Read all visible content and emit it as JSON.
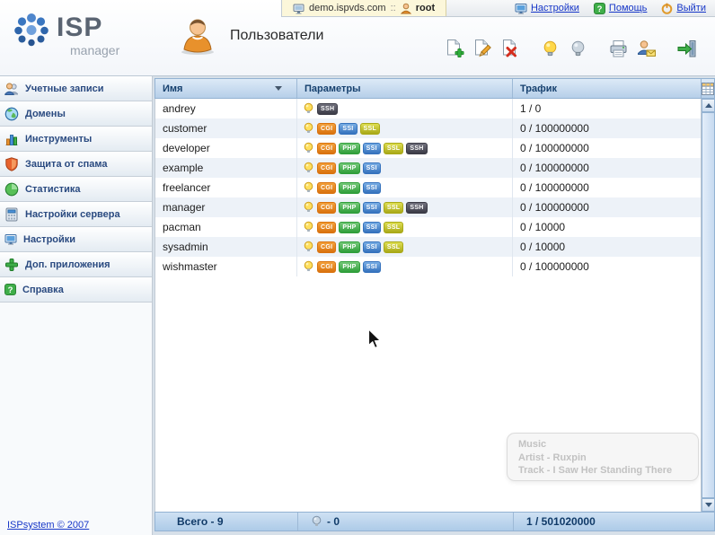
{
  "topbar": {
    "host": "demo.ispvds.com",
    "separator": "::",
    "user": "root",
    "links": [
      {
        "name": "settings-link",
        "icon": "monitor-icon",
        "label": "Настройки"
      },
      {
        "name": "help-link",
        "icon": "question-icon",
        "label": "Помощь"
      },
      {
        "name": "logout-link",
        "icon": "power-icon",
        "label": "Выйти"
      }
    ]
  },
  "logo": {
    "top": "ISP",
    "bottom": "manager"
  },
  "header": {
    "title": "Пользователи"
  },
  "toolbar": [
    {
      "name": "new-user-button",
      "icon": "doc-add-icon",
      "gap": false
    },
    {
      "name": "edit-user-button",
      "icon": "doc-edit-icon",
      "gap": false
    },
    {
      "name": "delete-user-button",
      "icon": "doc-delete-icon",
      "gap": false
    },
    {
      "name": "enable-user-button",
      "icon": "bulb-on-icon",
      "gap": true
    },
    {
      "name": "disable-user-button",
      "icon": "bulb-off-icon",
      "gap": false
    },
    {
      "name": "print-button",
      "icon": "printer-icon",
      "gap": true
    },
    {
      "name": "mail-password-button",
      "icon": "user-mail-icon",
      "gap": false
    },
    {
      "name": "login-as-user-button",
      "icon": "login-icon",
      "gap": true
    }
  ],
  "sidebar": {
    "items": [
      {
        "name": "accounts",
        "icon": "accounts-icon",
        "label": "Учетные записи"
      },
      {
        "name": "domains",
        "icon": "globe-icon",
        "label": "Домены"
      },
      {
        "name": "tools",
        "icon": "chart-icon",
        "label": "Инструменты"
      },
      {
        "name": "antispam",
        "icon": "shield-icon",
        "label": "Защита от спама"
      },
      {
        "name": "statistics",
        "icon": "stats-icon",
        "label": "Статистика"
      },
      {
        "name": "server-settings",
        "icon": "server-icon",
        "label": "Настройки сервера"
      },
      {
        "name": "settings",
        "icon": "monitor-icon",
        "label": "Настройки"
      },
      {
        "name": "addons",
        "icon": "plus-icon",
        "label": "Доп. приложения"
      },
      {
        "name": "help",
        "icon": "question-icon",
        "label": "Справка"
      }
    ],
    "copyright": "ISPsystem © 2007"
  },
  "table": {
    "columns": [
      {
        "label": "Имя",
        "sorted": true
      },
      {
        "label": "Параметры",
        "sorted": false
      },
      {
        "label": "Трафик",
        "sorted": false
      }
    ],
    "rows": [
      {
        "name": "andrey",
        "enabled": true,
        "badges": [
          "SSH"
        ],
        "traffic": "1 / 0"
      },
      {
        "name": "customer",
        "enabled": true,
        "badges": [
          "CGI",
          "SSI",
          "SSL"
        ],
        "traffic": "0 / 100000000"
      },
      {
        "name": "developer",
        "enabled": true,
        "badges": [
          "CGI",
          "PHP",
          "SSI",
          "SSL",
          "SSH"
        ],
        "traffic": "0 / 100000000"
      },
      {
        "name": "example",
        "enabled": true,
        "badges": [
          "CGI",
          "PHP",
          "SSI"
        ],
        "traffic": "0 / 100000000"
      },
      {
        "name": "freelancer",
        "enabled": true,
        "badges": [
          "CGI",
          "PHP",
          "SSI"
        ],
        "traffic": "0 / 100000000"
      },
      {
        "name": "manager",
        "enabled": true,
        "badges": [
          "CGI",
          "PHP",
          "SSI",
          "SSL",
          "SSH"
        ],
        "traffic": "0 / 100000000"
      },
      {
        "name": "pacman",
        "enabled": true,
        "badges": [
          "CGI",
          "PHP",
          "SSI",
          "SSL"
        ],
        "traffic": "0 / 10000"
      },
      {
        "name": "sysadmin",
        "enabled": true,
        "badges": [
          "CGI",
          "PHP",
          "SSI",
          "SSL"
        ],
        "traffic": "0 / 10000"
      },
      {
        "name": "wishmaster",
        "enabled": true,
        "badges": [
          "CGI",
          "PHP",
          "SSI"
        ],
        "traffic": "0 / 100000000"
      }
    ],
    "footer": {
      "total": "Всего - 9",
      "disabled_count": "- 0",
      "traffic_total": "1 / 501020000"
    }
  },
  "badge_colors": {
    "CGI": [
      "#f2a13c",
      "#d9720e"
    ],
    "PHP": [
      "#76c97a",
      "#2f9e3a"
    ],
    "SSI": [
      "#79aee4",
      "#3572bd"
    ],
    "SSL": [
      "#dede52",
      "#a9a918"
    ],
    "SSH": [
      "#72727e",
      "#3b3b46"
    ]
  },
  "overlay": {
    "lines": [
      "Music",
      "Artist - Ruxpin",
      "Track - I Saw Her Standing There"
    ]
  }
}
